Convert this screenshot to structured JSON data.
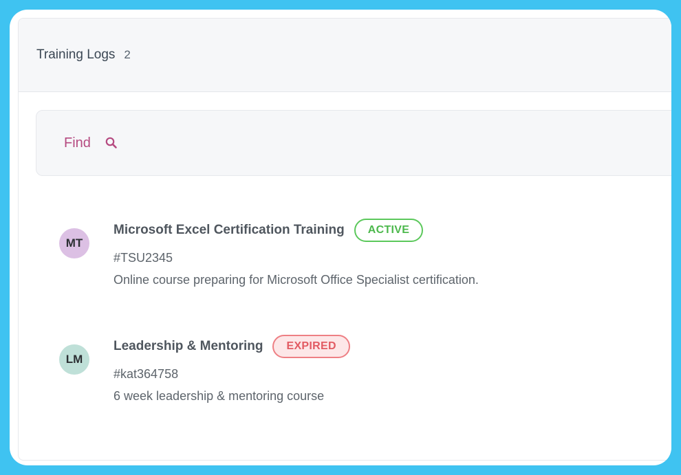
{
  "header": {
    "title": "Training Logs",
    "count": "2"
  },
  "search": {
    "label": "Find",
    "icon": "search-icon"
  },
  "logs": [
    {
      "initials": "MT",
      "avatar_color": "#dcc0e4",
      "title": "Microsoft Excel Certification Training",
      "status": "ACTIVE",
      "status_color": "#4cb84c",
      "id": "#TSU2345",
      "description": "Online course preparing for Microsoft Office Specialist certification."
    },
    {
      "initials": "LM",
      "avatar_color": "#bfe0d8",
      "title": "Leadership & Mentoring",
      "status": "EXPIRED",
      "status_color": "#e25b63",
      "id": "#kat364758",
      "description": "6 week leadership & mentoring course"
    }
  ],
  "colors": {
    "frame": "#3fc3f1",
    "accent": "#b54a80"
  }
}
